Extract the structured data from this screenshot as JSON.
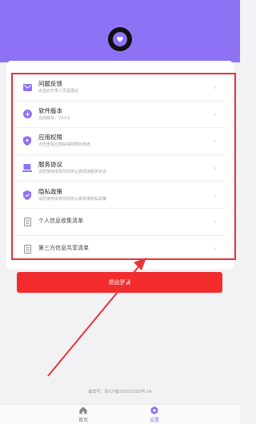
{
  "settings_list": [
    {
      "title": "问题反馈",
      "subtitle": "点击此开发人员提建议",
      "icon": "mail-icon"
    },
    {
      "title": "软件版本",
      "subtitle": "当前版本：V3.0.6",
      "icon": "download-icon"
    },
    {
      "title": "应用权限",
      "subtitle": "点击查看应用获得权限的用途",
      "icon": "shield-icon"
    },
    {
      "title": "服务协议",
      "subtitle": "请您使用本软件前务认真阅读服务协议",
      "icon": "laptop-icon"
    },
    {
      "title": "隐私政策",
      "subtitle": "请您使用本软件前务认真阅读隐私政策",
      "icon": "shield-check-icon"
    },
    {
      "title": "个人信息收集清单",
      "subtitle": "",
      "icon": "document-list-icon"
    },
    {
      "title": "第三方信息共享清单",
      "subtitle": "",
      "icon": "document-list-icon"
    }
  ],
  "logout_label": "退出登录",
  "icp_text": "备案号：鄂ICP备2022013335号-2A",
  "tabs": [
    {
      "label": "首页",
      "icon": "home-icon"
    },
    {
      "label": "设置",
      "icon": "gear-icon"
    }
  ],
  "colors": {
    "accent": "#8e72f6",
    "logout": "#f22c2c",
    "highlight": "#e8333a"
  }
}
